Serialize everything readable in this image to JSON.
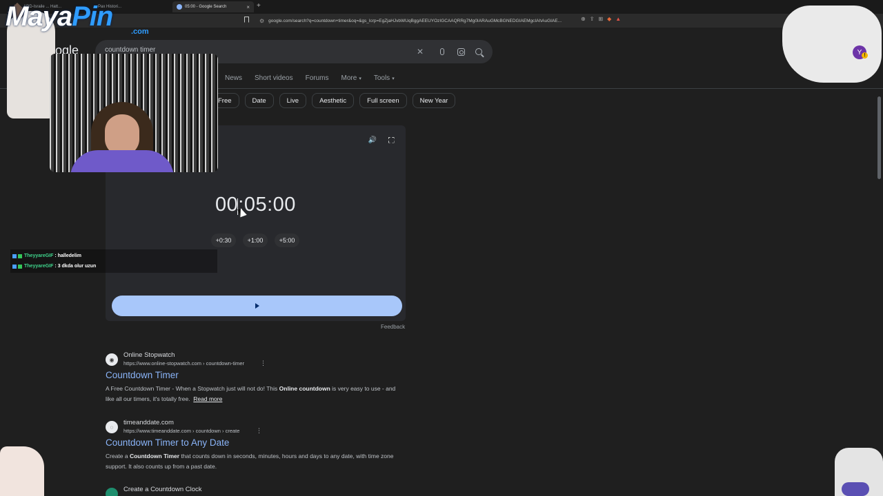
{
  "browser": {
    "tabs": [
      {
        "label": "#C... ARD-Israile ... Hatt...",
        "active": false
      },
      {
        "label": "Pax Histori...",
        "active": false
      },
      {
        "label": "05:00 - Google Search",
        "active": true
      }
    ],
    "new_tab_symbol": "+",
    "url": "google.com/search?q=countdown+timer&oq=&gs_lcrp=EgZjaHJvbWUqBggAEEUYOzIGCAAQRRg7Mg0IARAuGMcBGNEDGIAEMgcIAhAuGIAE..."
  },
  "google": {
    "logo_text": "oogle",
    "search": {
      "value": "countdown timer",
      "clear_symbol": "✕"
    },
    "nav_tabs": [
      {
        "label": "News"
      },
      {
        "label": "Short videos"
      },
      {
        "label": "Forums"
      },
      {
        "label": "More",
        "caret": "▾"
      },
      {
        "label": "Tools",
        "caret": "▾"
      }
    ],
    "chips": [
      "Free",
      "Date",
      "Live",
      "Aesthetic",
      "Full screen",
      "New Year"
    ],
    "avatar_letter": "Y",
    "avatar_badge": "!"
  },
  "timer": {
    "time": "00:05:00",
    "add_buttons": [
      "+0:30",
      "+1:00",
      "+5:00"
    ],
    "volume_symbol": "🔊",
    "feedback": "Feedback"
  },
  "results": [
    {
      "site": "Online Stopwatch",
      "url": "https://www.online-stopwatch.com › countdown-timer",
      "title": "Countdown Timer",
      "snippet_parts": [
        {
          "text": "A Free Countdown Timer - When a Stopwatch just will not do! This ",
          "bold": false
        },
        {
          "text": "Online countdown",
          "bold": true
        },
        {
          "text": " is very easy to use - and like all our timers, it's totally free.",
          "bold": false
        }
      ],
      "read_more": "Read more",
      "more_symbol": "⋮"
    },
    {
      "site": "timeanddate.com",
      "url": "https://www.timeanddate.com › countdown › create",
      "title": "Countdown Timer to Any Date",
      "snippet_parts": [
        {
          "text": "Create a ",
          "bold": false
        },
        {
          "text": "Countdown Timer",
          "bold": true
        },
        {
          "text": " that counts down in seconds, minutes, hours and days to any date, with time zone support. It also counts up from a past date.",
          "bold": false
        }
      ],
      "more_symbol": "⋮"
    },
    {
      "site": "Create a Countdown Clock"
    }
  ],
  "overlay": {
    "logo_main": "Maya",
    "logo_accent": "Pin",
    "logo_domain": ".com",
    "chat": [
      {
        "user": "TheyyareGIF",
        "message": ": halledelim"
      },
      {
        "user": "TheyyareGIF",
        "message": ": 3 dkda olur uzun"
      }
    ]
  },
  "colors": {
    "background": "#1f1f1f",
    "link": "#8ab4f8",
    "play_button": "#a8c7fa",
    "card": "#28292d"
  }
}
